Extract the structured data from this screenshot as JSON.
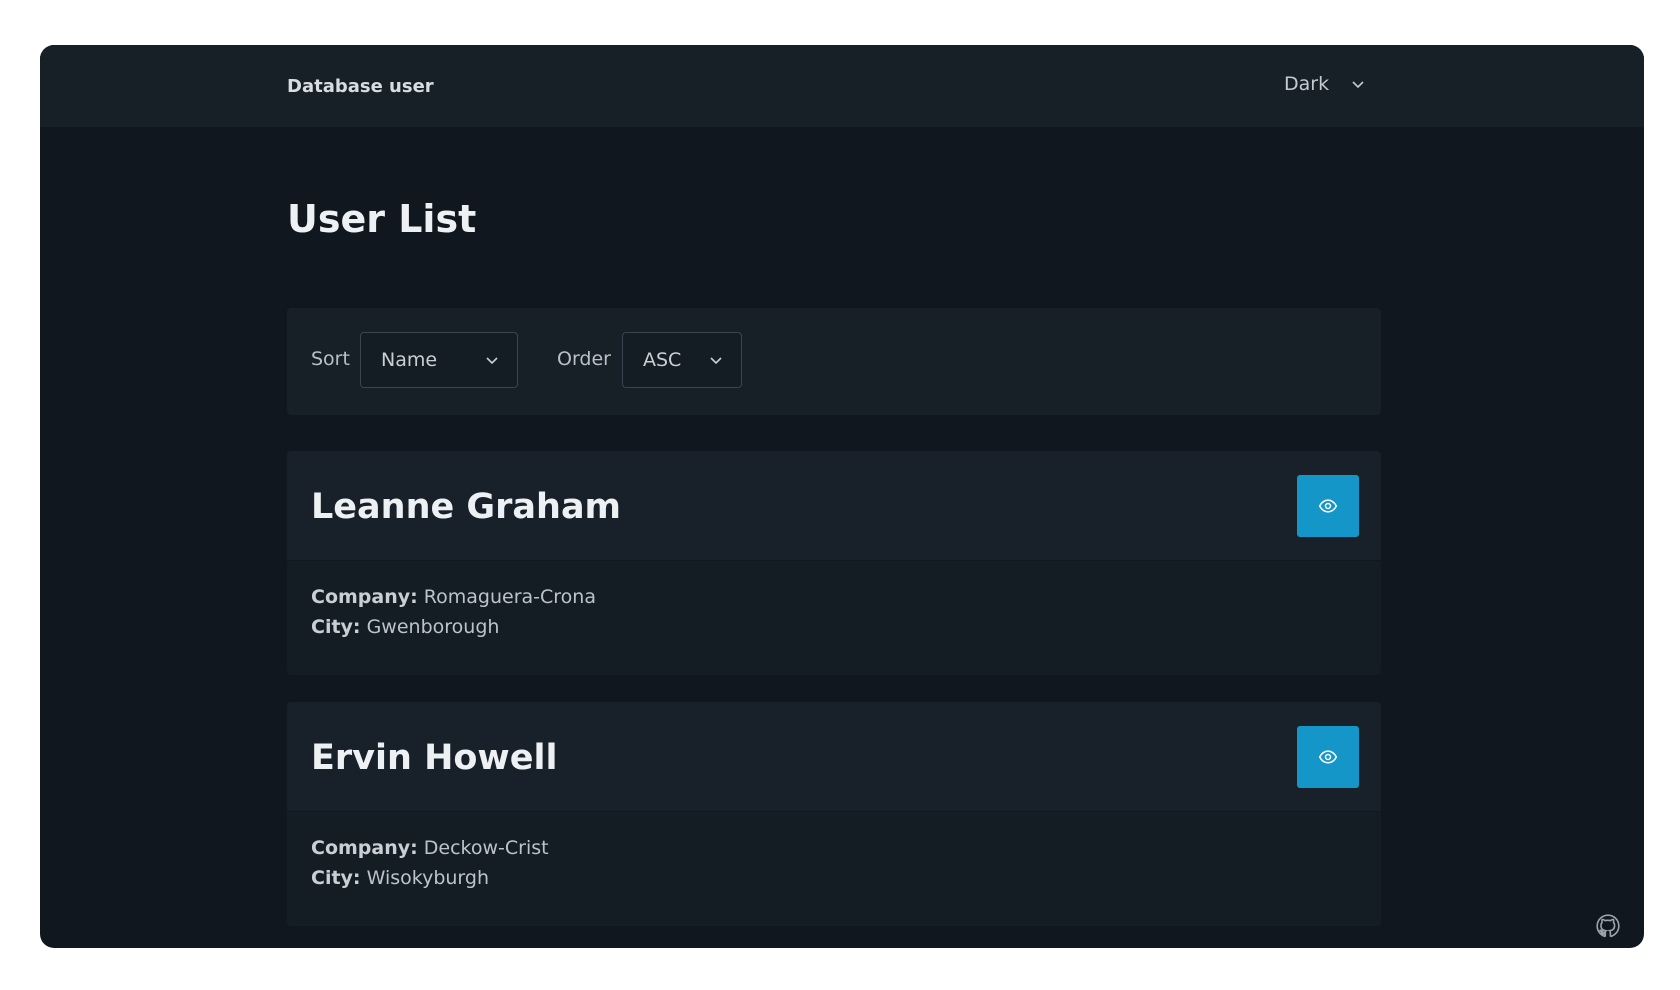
{
  "navbar": {
    "brand": "Database user",
    "theme_value": "Dark"
  },
  "page": {
    "title": "User List"
  },
  "filters": {
    "sort_label": "Sort",
    "sort_value": "Name",
    "order_label": "Order",
    "order_value": "ASC"
  },
  "users": [
    {
      "name": "Leanne Graham",
      "company_label": "Company:",
      "company": "Romaguera-Crona",
      "city_label": "City:",
      "city": "Gwenborough"
    },
    {
      "name": "Ervin Howell",
      "company_label": "Company:",
      "company": "Deckow-Crist",
      "city_label": "City:",
      "city": "Wisokyburgh"
    }
  ],
  "colors": {
    "background": "#10171e",
    "accent": "#1596c8"
  },
  "icons": {
    "view": "eye-icon",
    "dropdown": "chevron-down-icon",
    "footer": "github-icon"
  }
}
